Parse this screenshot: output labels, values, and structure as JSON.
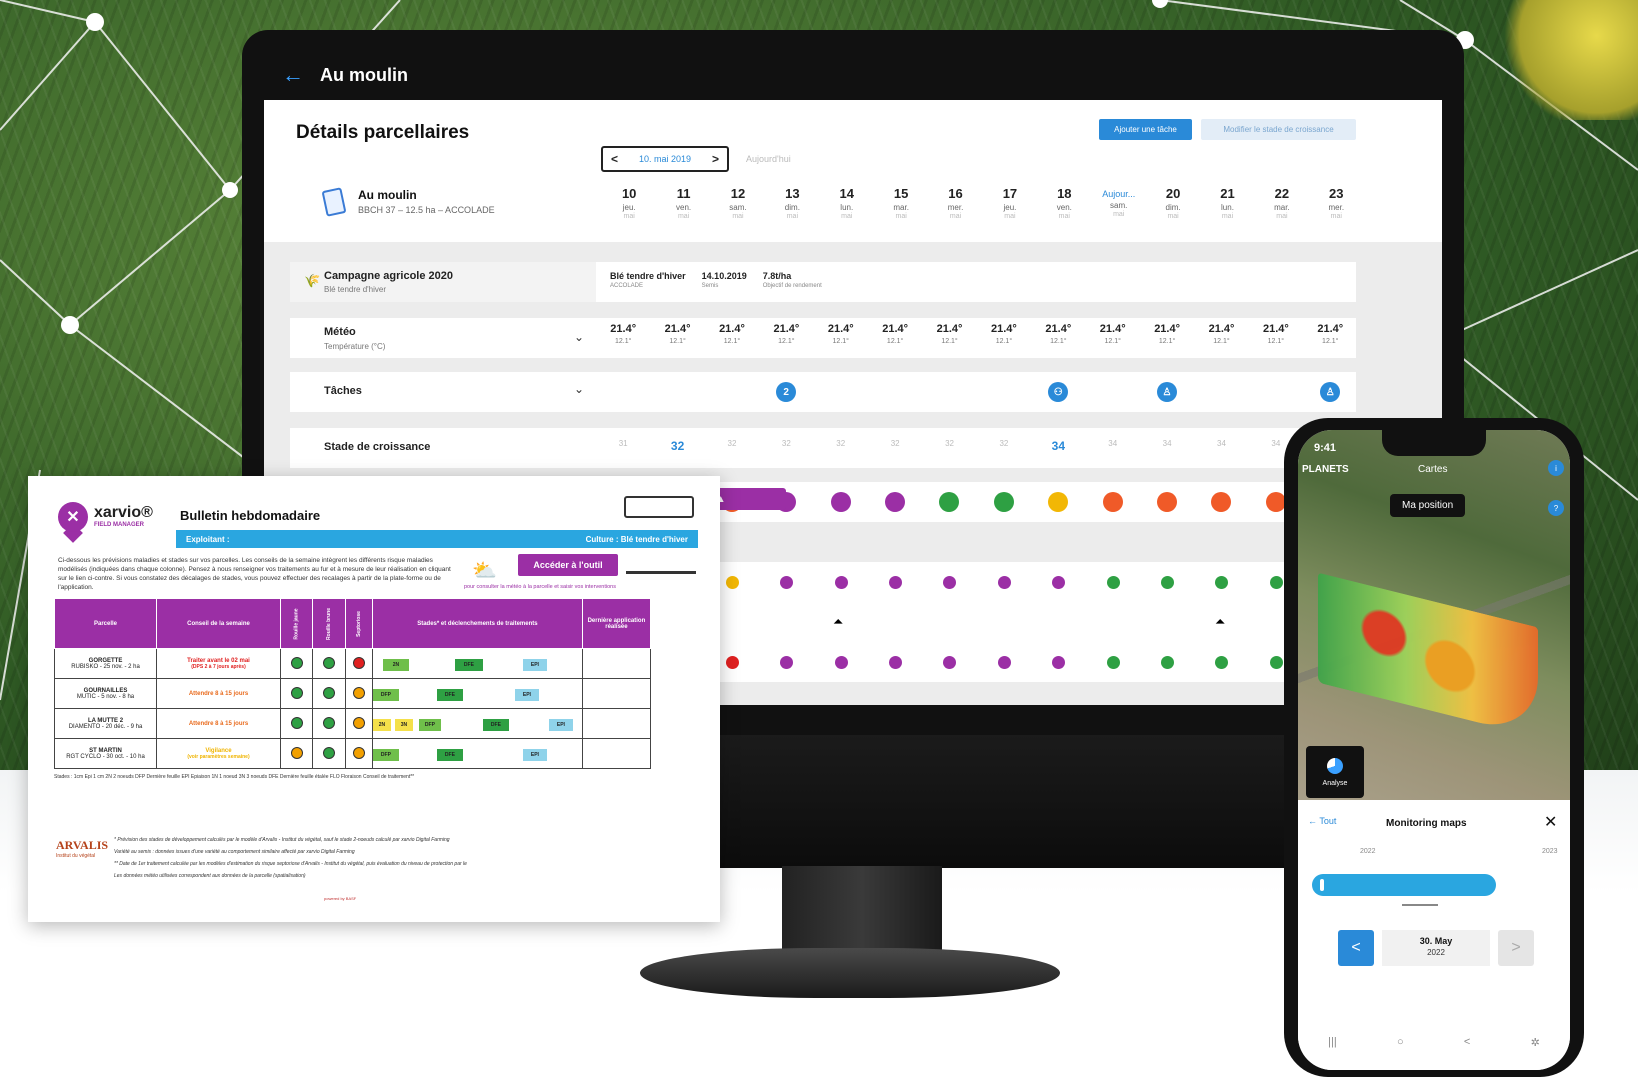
{
  "desktop": {
    "window_title": "Au moulin",
    "page_title": "Détails parcellaires",
    "field": {
      "name": "Au moulin",
      "subtitle": "BBCH 37 – 12.5 ha – ACCOLADE"
    },
    "date_nav": {
      "current": "10. mai 2019",
      "today_label": "Aujourd'hui"
    },
    "buttons": {
      "add_task": "Ajouter une tâche",
      "edit_stage": "Modifier le stade de croissance"
    },
    "days": [
      {
        "num": "10",
        "dow": "jeu.",
        "mon": "mai"
      },
      {
        "num": "11",
        "dow": "ven.",
        "mon": "mai"
      },
      {
        "num": "12",
        "dow": "sam.",
        "mon": "mai"
      },
      {
        "num": "13",
        "dow": "dim.",
        "mon": "mai"
      },
      {
        "num": "14",
        "dow": "lun.",
        "mon": "mai"
      },
      {
        "num": "15",
        "dow": "mar.",
        "mon": "mai"
      },
      {
        "num": "16",
        "dow": "mer.",
        "mon": "mai"
      },
      {
        "num": "17",
        "dow": "jeu.",
        "mon": "mai"
      },
      {
        "num": "18",
        "dow": "ven.",
        "mon": "mai"
      },
      {
        "num": "Aujour...",
        "dow": "sam.",
        "mon": "mai",
        "today": true
      },
      {
        "num": "20",
        "dow": "dim.",
        "mon": "mai"
      },
      {
        "num": "21",
        "dow": "lun.",
        "mon": "mai"
      },
      {
        "num": "22",
        "dow": "mar.",
        "mon": "mai"
      },
      {
        "num": "23",
        "dow": "mer.",
        "mon": "mai"
      }
    ],
    "campaign": {
      "label": "Campagne agricole 2020",
      "sublabel": "Blé tendre d'hiver",
      "crop": {
        "value": "Blé tendre d'hiver",
        "key": "ACCOLADE"
      },
      "sowing": {
        "value": "14.10.2019",
        "key": "Semis"
      },
      "target": {
        "value": "7.8t/ha",
        "key": "Objectif de rendement"
      }
    },
    "meteo": {
      "label": "Météo",
      "sublabel": "Température (°C)",
      "hi": [
        "21.4°",
        "21.4°",
        "21.4°",
        "21.4°",
        "21.4°",
        "21.4°",
        "21.4°",
        "21.4°",
        "21.4°",
        "21.4°",
        "21.4°",
        "21.4°",
        "21.4°",
        "21.4°"
      ],
      "lo": [
        "12.1°",
        "12.1°",
        "12.1°",
        "12.1°",
        "12.1°",
        "12.1°",
        "12.1°",
        "12.1°",
        "12.1°",
        "12.1°",
        "12.1°",
        "12.1°",
        "12.1°",
        "12.1°"
      ]
    },
    "tasks": {
      "label": "Tâches",
      "items": [
        {
          "day_index": 3,
          "text": "2"
        },
        {
          "day_index": 8,
          "text": "⚇"
        },
        {
          "day_index": 10,
          "text": "♙"
        },
        {
          "day_index": 13,
          "text": "♙"
        }
      ]
    },
    "growth": {
      "label": "Stade de croissance",
      "stages": [
        "31",
        "32",
        "32",
        "32",
        "32",
        "32",
        "32",
        "32",
        "34",
        "34",
        "34",
        "34",
        "34",
        "34"
      ],
      "highlight": [
        1,
        8
      ]
    },
    "risk_pill": "⚇ ▲",
    "colors": {
      "accent": "#2a8ad8",
      "purple": "#9b2fa5",
      "green": "#2ea043",
      "orange": "#f05a28",
      "yellow": "#f2b705",
      "red": "#e02020"
    }
  },
  "bulletin": {
    "brand": "xarvio®",
    "brand_sub": "FIELD MANAGER",
    "title": "Bulletin hebdomadaire",
    "exploitant": "Exploitant :",
    "culture": "Culture : Blé tendre d'hiver",
    "intro": "Ci-dessous les prévisions maladies et stades sur vos parcelles. Les conseils de la semaine intègrent les différents risque maladies modélisés (indiquées dans chaque colonne). Pensez à nous renseigner vos traitements au fur et à mesure de leur réalisation en cliquant sur le lien ci-contre. Si vous constatez des décalages de stades, vous pouvez effectuer des recalages à partir de la plate-forme ou de l'application.",
    "cta": "Accéder à l'outil",
    "cta_sub": "pour consulter la météo à la parcelle et saisir vos interventions",
    "columns": {
      "parcel": "Parcelle",
      "advice": "Conseil de la semaine",
      "c1": "Rouille jaune",
      "c2": "Rouille brune",
      "c3": "Septoriose",
      "stages": "Stades* et déclenchements de traitements",
      "last": "Dernière application réalisée"
    },
    "rows": [
      {
        "parcel": "GORGETTE",
        "sub": "RUBISKO - 25 nov. - 2 ha",
        "advice": "Traiter avant le 02 mai",
        "advice_sub": "(DPS 2 à 7 jours après)",
        "tone": "red"
      },
      {
        "parcel": "GOURNAILLES",
        "sub": "MUTIC - 5 nov. - 8 ha",
        "advice": "Attendre 8 à 15 jours",
        "advice_sub": "",
        "tone": "orange"
      },
      {
        "parcel": "LA MUTTE 2",
        "sub": "DIAMENTO - 20 déc. - 9 ha",
        "advice": "Attendre 8 à 15 jours",
        "advice_sub": "",
        "tone": "orange"
      },
      {
        "parcel": "ST MARTIN",
        "sub": "RGT CYCLO - 30 oct. - 10 ha",
        "advice": "Vigilance",
        "advice_sub": "(voir paramètres semaine)",
        "tone": "yellow"
      }
    ],
    "legend": "Stades :   1cm Epi 1 cm   2N 2 noeuds   DFP Dernière feuille   EPI Epiaison   1N 1 noeud   3N 3 noeuds   DFE Dernière feuille étalée   FLO Floraison   Conseil de traitement**",
    "arvalis": "ARVALIS",
    "arvalis_sub": "Institut du végétal",
    "note1": "* Prévision des stades de développement calculés par le modèle d'Arvalis - Institut du végétal, sauf le stade 2-noeuds calculé par xarvio Digital Farming",
    "note2": "Variété au semis : données issues d'une variété au comportement similaire affecté par xarvio Digital Farming",
    "note3": "** Date de 1er traitement calculée par les modèles d'estimation du risque septoriose d'Arvalis - Institut du végétal, puis évaluation du niveau de protection par le",
    "note4": "Les données météo utilisées correspondent aux données de la parcelle (spatialisation)",
    "footer": "powered by BASF"
  },
  "phone": {
    "time": "9:41",
    "place": "PLANETS",
    "map_tab": "Cartes",
    "my_position": "Ma position",
    "analyse": "Analyse",
    "sheet": {
      "back": "Tout",
      "title": "Monitoring maps",
      "year_left": "2022",
      "year_right": "2023",
      "date": "30. May",
      "date_year": "2022"
    }
  }
}
